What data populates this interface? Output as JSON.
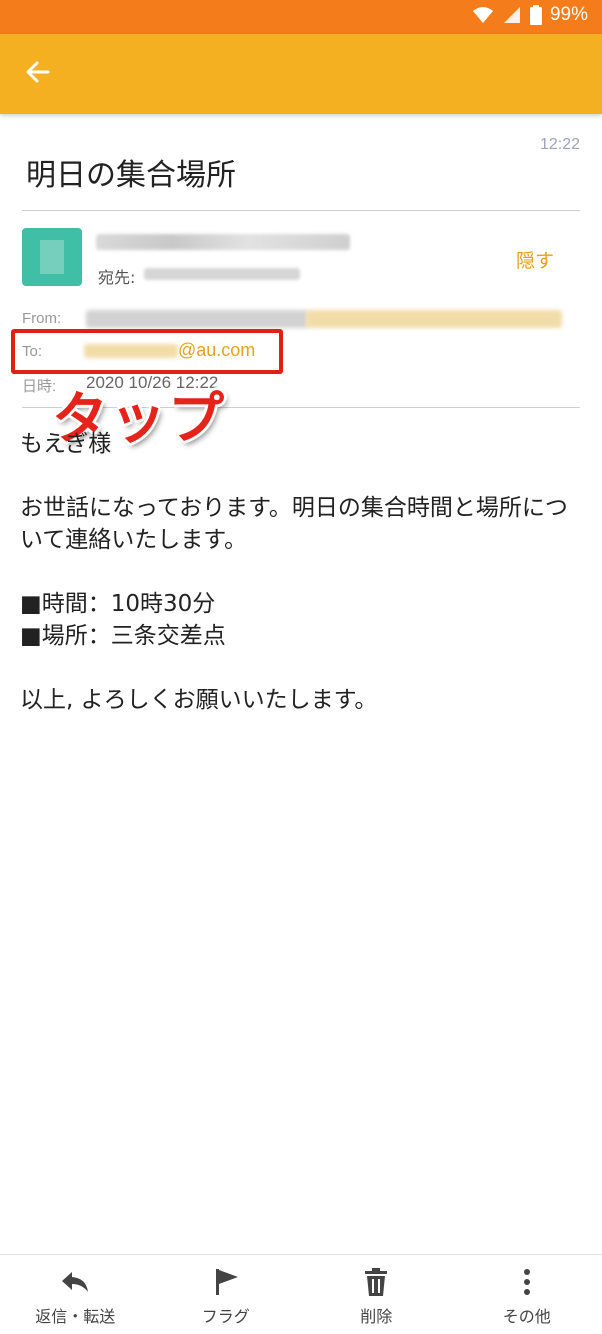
{
  "status_bar": {
    "battery": "99%",
    "icons": [
      "wifi-icon",
      "signal-icon",
      "battery-icon"
    ]
  },
  "app_bar": {
    "back_icon": "arrow-left-icon",
    "color": "#f4b020"
  },
  "email": {
    "subject": "明日の集合場所",
    "time": "12:22",
    "to_label": "宛先:",
    "hide_label": "隠す",
    "from_label": "From:",
    "to_field_label": "To:",
    "to_domain": "@au.com",
    "date_label": "日時:",
    "date_value": "2020 10/26 12:22"
  },
  "annotation": {
    "tap_label": "タップ",
    "color": "#e5231a"
  },
  "body": {
    "greeting": "もえぎ様",
    "line1": "お世話になっております。明日の集合時間と場所について連絡いたします。",
    "line2": "■時間：10時30分",
    "line3": "■場所：三条交差点",
    "closing": "以上, よろしくお願いいたします。"
  },
  "bottom_bar": {
    "items": [
      {
        "label": "返信・転送",
        "icon": "reply-icon"
      },
      {
        "label": "フラグ",
        "icon": "flag-icon"
      },
      {
        "label": "削除",
        "icon": "trash-icon"
      },
      {
        "label": "その他",
        "icon": "more-icon"
      }
    ]
  }
}
